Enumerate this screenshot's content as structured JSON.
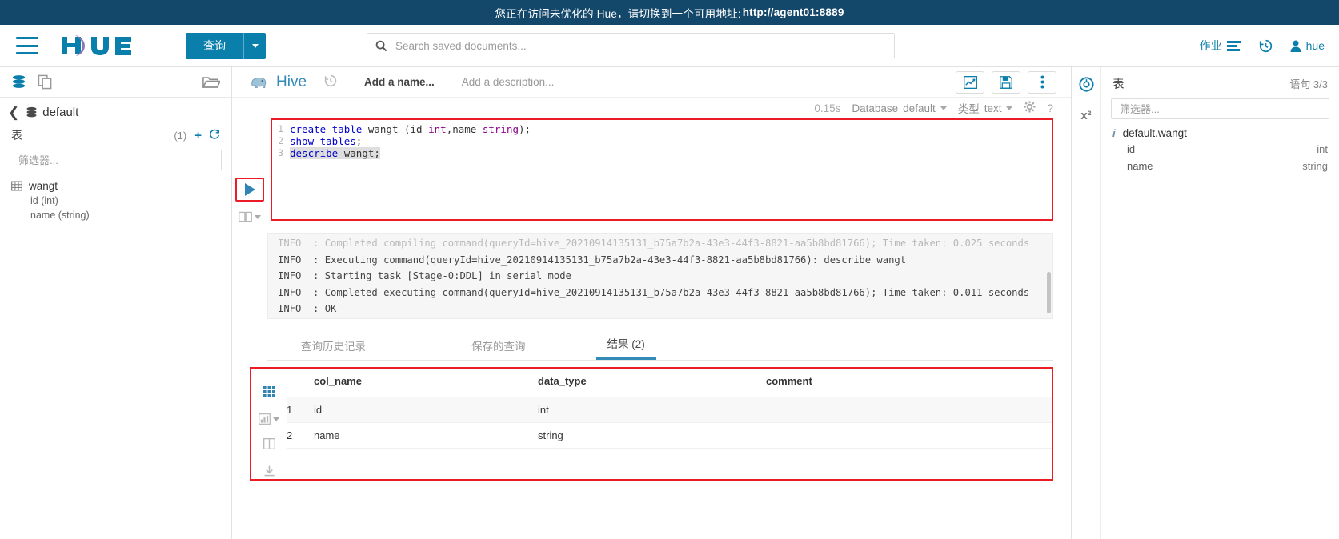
{
  "banner": {
    "text": "您正在访问未优化的 Hue，请切换到一个可用地址:",
    "url": "http://agent01:8889"
  },
  "navbar": {
    "logo_alt": "hue",
    "query_button": "查询",
    "search_placeholder": "Search saved documents...",
    "jobs_label": "作业",
    "user_label": "hue"
  },
  "left_panel": {
    "breadcrumb_db": "default",
    "section_label": "表",
    "count": "(1)",
    "filter_placeholder": "筛选器...",
    "tables": [
      {
        "name": "wangt",
        "columns": [
          "id (int)",
          "name (string)"
        ]
      }
    ]
  },
  "editor": {
    "engine": "Hive",
    "name_placeholder": "Add a name...",
    "description_placeholder": "Add a description...",
    "duration": "0.15s",
    "database_label": "Database",
    "database_value": "default",
    "type_label": "类型",
    "type_value": "text",
    "help_label": "?",
    "code_lines": [
      {
        "num": "1",
        "selected": false,
        "tokens": [
          {
            "cls": "k",
            "text": "create table "
          },
          {
            "cls": "t",
            "text": "wangt "
          },
          {
            "cls": "p",
            "text": "(id "
          },
          {
            "cls": "ty",
            "text": "int"
          },
          {
            "cls": "p",
            "text": ",name "
          },
          {
            "cls": "ty",
            "text": "string"
          },
          {
            "cls": "p",
            "text": ");"
          }
        ]
      },
      {
        "num": "2",
        "selected": false,
        "tokens": [
          {
            "cls": "k",
            "text": "show tables"
          },
          {
            "cls": "p",
            "text": ";"
          }
        ]
      },
      {
        "num": "3",
        "selected": true,
        "tokens": [
          {
            "cls": "k",
            "text": "describe "
          },
          {
            "cls": "t",
            "text": "wangt"
          },
          {
            "cls": "p",
            "text": ";"
          }
        ]
      }
    ]
  },
  "logs": {
    "lines": [
      "INFO  : Completed compiling command(queryId=hive_20210914135131_b75a7b2a-43e3-44f3-8821-aa5b8bd81766); Time taken: 0.025 seconds",
      "INFO  : Executing command(queryId=hive_20210914135131_b75a7b2a-43e3-44f3-8821-aa5b8bd81766): describe wangt",
      "INFO  : Starting task [Stage-0:DDL] in serial mode",
      "INFO  : Completed executing command(queryId=hive_20210914135131_b75a7b2a-43e3-44f3-8821-aa5b8bd81766); Time taken: 0.011 seconds",
      "INFO  : OK"
    ]
  },
  "tabs": {
    "history": "查询历史记录",
    "saved": "保存的查询",
    "results": "结果 (2)"
  },
  "results": {
    "headers": [
      "col_name",
      "data_type",
      "comment"
    ],
    "rows": [
      {
        "idx": "1",
        "col_name": "id",
        "data_type": "int",
        "comment": ""
      },
      {
        "idx": "2",
        "col_name": "name",
        "data_type": "string",
        "comment": ""
      }
    ]
  },
  "right_panel": {
    "title": "表",
    "statement": "语句 3/3",
    "filter_placeholder": "筛选器...",
    "table_name": "default.wangt",
    "columns": [
      {
        "name": "id",
        "type": "int"
      },
      {
        "name": "name",
        "type": "string"
      }
    ]
  },
  "colors": {
    "banner_bg": "#14486b",
    "accent": "#0b7fab",
    "annotation": "#ec1c24",
    "tab_active": "#338bb8"
  }
}
